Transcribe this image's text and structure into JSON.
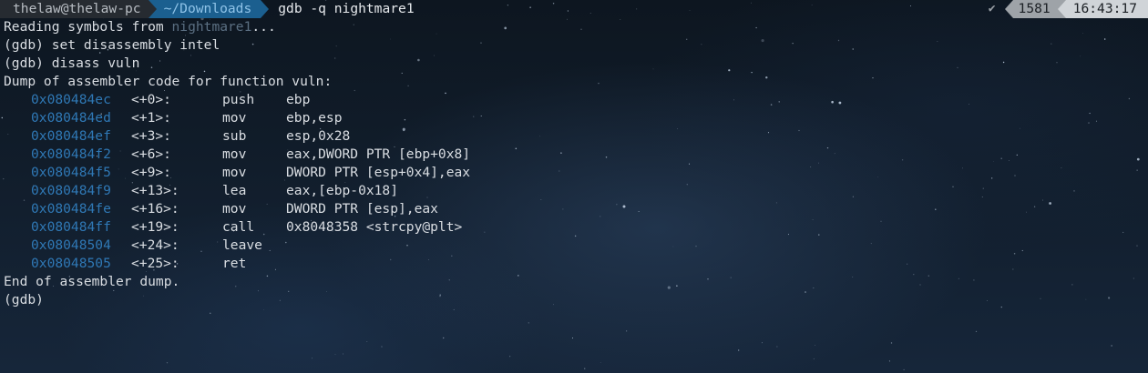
{
  "prompt": {
    "user": "thelaw@thelaw-pc",
    "path": "~/Downloads",
    "command": "gdb -q nightmare1",
    "status_check": "✔",
    "history_number": "1581",
    "time": "16:43:17"
  },
  "output": {
    "reading_prefix": "Reading symbols from ",
    "reading_file": "nightmare1",
    "reading_suffix": "...",
    "cmd1": "(gdb) set disassembly intel",
    "cmd2": "(gdb) disass vuln",
    "dump_header": "Dump of assembler code for function vuln:",
    "asm": [
      {
        "addr": "0x080484ec",
        "off": "<+0>:",
        "mn": "push",
        "ops": "ebp"
      },
      {
        "addr": "0x080484ed",
        "off": "<+1>:",
        "mn": "mov",
        "ops": "ebp,esp"
      },
      {
        "addr": "0x080484ef",
        "off": "<+3>:",
        "mn": "sub",
        "ops": "esp,0x28"
      },
      {
        "addr": "0x080484f2",
        "off": "<+6>:",
        "mn": "mov",
        "ops": "eax,DWORD PTR [ebp+0x8]"
      },
      {
        "addr": "0x080484f5",
        "off": "<+9>:",
        "mn": "mov",
        "ops": "DWORD PTR [esp+0x4],eax"
      },
      {
        "addr": "0x080484f9",
        "off": "<+13>:",
        "mn": "lea",
        "ops": "eax,[ebp-0x18]"
      },
      {
        "addr": "0x080484fe",
        "off": "<+16>:",
        "mn": "mov",
        "ops": "DWORD PTR [esp],eax"
      },
      {
        "addr": "0x080484ff",
        "off": "<+19>:",
        "mn": "call",
        "ops": "0x8048358 <strcpy@plt>"
      },
      {
        "addr": "0x08048504",
        "off": "<+24>:",
        "mn": "leave",
        "ops": ""
      },
      {
        "addr": "0x08048505",
        "off": "<+25>:",
        "mn": "ret",
        "ops": ""
      }
    ],
    "dump_footer": "End of assembler dump.",
    "final_prompt": "(gdb)"
  }
}
